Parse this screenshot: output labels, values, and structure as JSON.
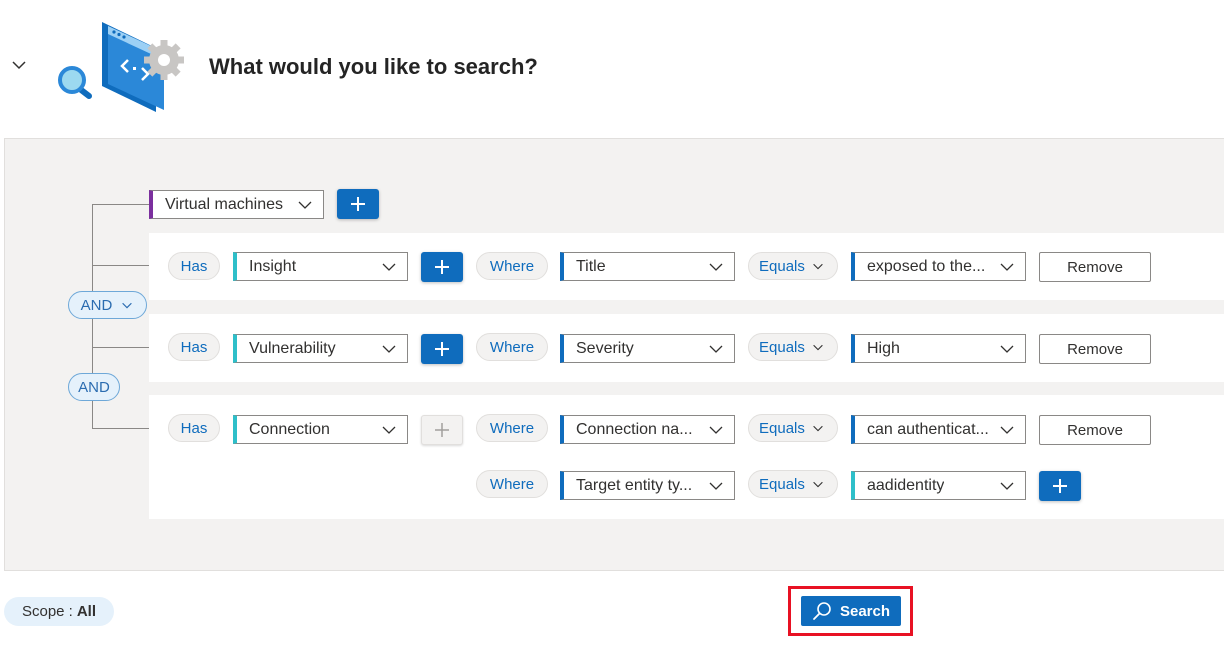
{
  "header": {
    "title": "What would you like to search?"
  },
  "builder": {
    "root_entity": "Virtual machines",
    "operators": [
      "AND",
      "AND"
    ],
    "rows": [
      {
        "has": "Has",
        "type": "Insight",
        "where": "Where",
        "field": "Title",
        "operator": "Equals",
        "value": "exposed to the...",
        "remove": "Remove"
      },
      {
        "has": "Has",
        "type": "Vulnerability",
        "where": "Where",
        "field": "Severity",
        "operator": "Equals",
        "value": "High",
        "remove": "Remove"
      },
      {
        "has": "Has",
        "type": "Connection",
        "where": "Where",
        "field": "Connection na...",
        "operator": "Equals",
        "value": "can authenticat...",
        "remove": "Remove",
        "sub": {
          "where": "Where",
          "field": "Target entity ty...",
          "operator": "Equals",
          "value": "aadidentity"
        }
      }
    ]
  },
  "footer": {
    "scope_label": "Scope :",
    "scope_value": "All",
    "search_label": "Search"
  },
  "colors": {
    "accent": "#0f6cbd",
    "purple": "#7b2f9e",
    "teal": "#2ebfc9",
    "highlight": "#e81123"
  }
}
